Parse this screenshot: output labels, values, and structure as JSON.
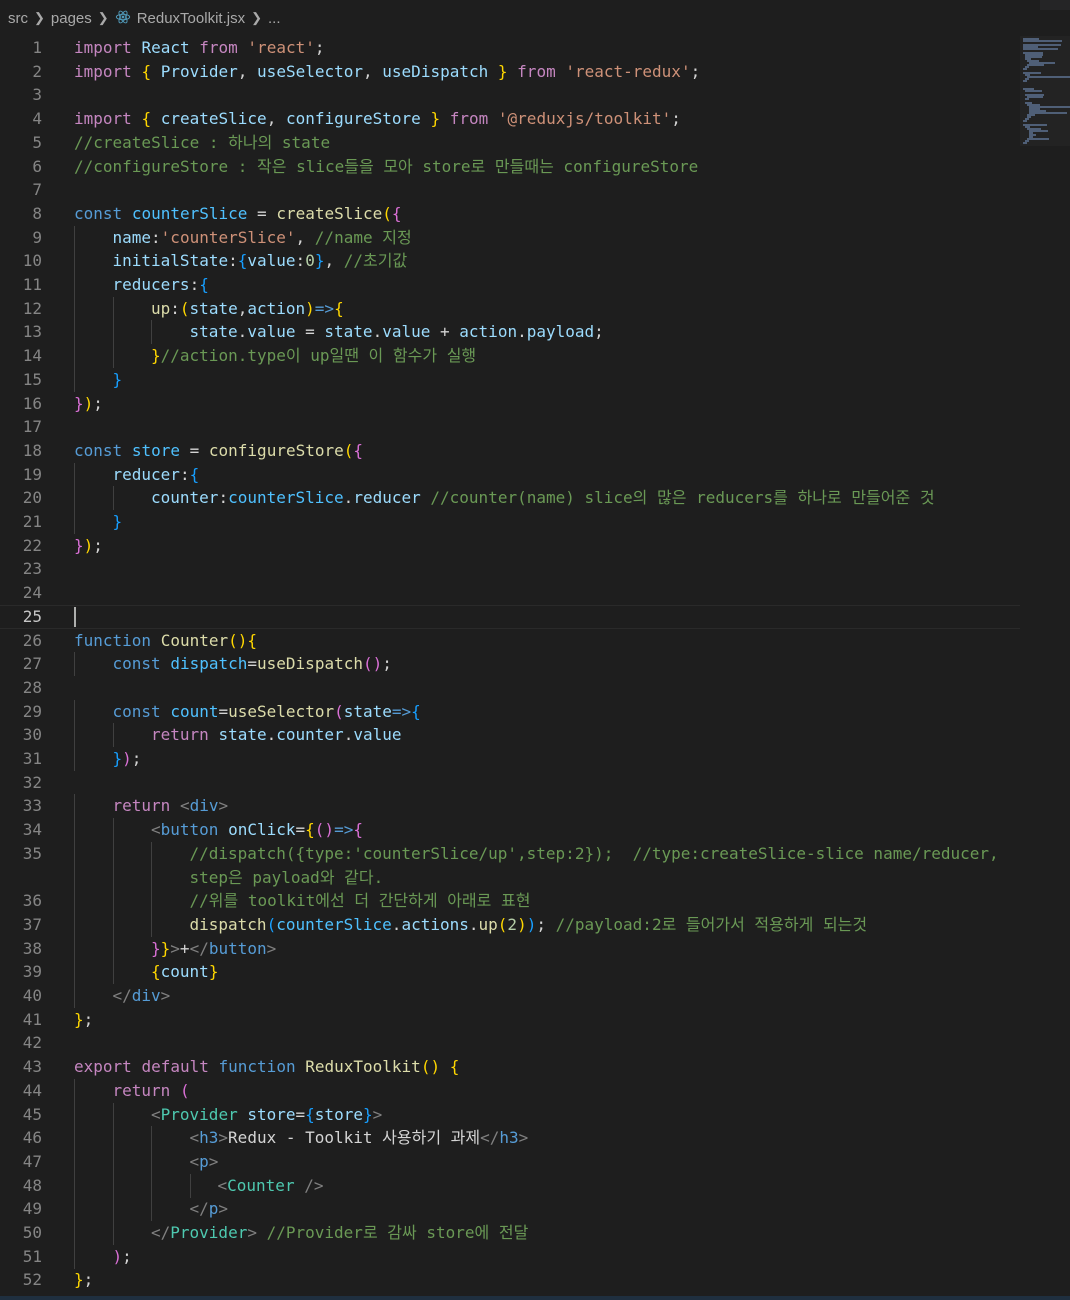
{
  "breadcrumb": {
    "items": [
      "src",
      "pages",
      "ReduxToolkit.jsx",
      "..."
    ]
  },
  "editor": {
    "current_line": 25,
    "lines": [
      {
        "n": "1",
        "indent": 0,
        "tokens": [
          [
            "c",
            "import"
          ],
          [
            "d",
            " "
          ],
          [
            "v",
            "React"
          ],
          [
            "d",
            " "
          ],
          [
            "c",
            "from"
          ],
          [
            "d",
            " "
          ],
          [
            "s",
            "'react'"
          ],
          [
            "d",
            ";"
          ]
        ]
      },
      {
        "n": "2",
        "indent": 0,
        "tokens": [
          [
            "c",
            "import"
          ],
          [
            "d",
            " "
          ],
          [
            "b1",
            "{"
          ],
          [
            "d",
            " "
          ],
          [
            "v",
            "Provider"
          ],
          [
            "d",
            ", "
          ],
          [
            "v",
            "useSelector"
          ],
          [
            "d",
            ", "
          ],
          [
            "v",
            "useDispatch"
          ],
          [
            "d",
            " "
          ],
          [
            "b1",
            "}"
          ],
          [
            "d",
            " "
          ],
          [
            "c",
            "from"
          ],
          [
            "d",
            " "
          ],
          [
            "s",
            "'react-redux'"
          ],
          [
            "d",
            ";"
          ]
        ]
      },
      {
        "n": "3",
        "indent": 0,
        "tokens": []
      },
      {
        "n": "4",
        "indent": 0,
        "tokens": [
          [
            "c",
            "import"
          ],
          [
            "d",
            " "
          ],
          [
            "b1",
            "{"
          ],
          [
            "d",
            " "
          ],
          [
            "v",
            "createSlice"
          ],
          [
            "d",
            ", "
          ],
          [
            "v",
            "configureStore"
          ],
          [
            "d",
            " "
          ],
          [
            "b1",
            "}"
          ],
          [
            "d",
            " "
          ],
          [
            "c",
            "from"
          ],
          [
            "d",
            " "
          ],
          [
            "s",
            "'@reduxjs/toolkit'"
          ],
          [
            "d",
            ";"
          ]
        ]
      },
      {
        "n": "5",
        "indent": 0,
        "tokens": [
          [
            "m",
            "//createSlice : 하나의 state"
          ]
        ]
      },
      {
        "n": "6",
        "indent": 0,
        "tokens": [
          [
            "m",
            "//configureStore : 작은 slice들을 모아 store로 만들때는 configureStore"
          ]
        ]
      },
      {
        "n": "7",
        "indent": 0,
        "tokens": []
      },
      {
        "n": "8",
        "indent": 0,
        "tokens": [
          [
            "k",
            "const"
          ],
          [
            "d",
            " "
          ],
          [
            "vc",
            "counterSlice"
          ],
          [
            "d",
            " = "
          ],
          [
            "f",
            "createSlice"
          ],
          [
            "b1",
            "("
          ],
          [
            "b2",
            "{"
          ]
        ]
      },
      {
        "n": "9",
        "indent": 1,
        "tokens": [
          [
            "v",
            "name"
          ],
          [
            "d",
            ":"
          ],
          [
            "s",
            "'counterSlice'"
          ],
          [
            "d",
            ", "
          ],
          [
            "m",
            "//name 지정"
          ]
        ]
      },
      {
        "n": "10",
        "indent": 1,
        "tokens": [
          [
            "v",
            "initialState"
          ],
          [
            "d",
            ":"
          ],
          [
            "b3",
            "{"
          ],
          [
            "v",
            "value"
          ],
          [
            "d",
            ":"
          ],
          [
            "n",
            "0"
          ],
          [
            "b3",
            "}"
          ],
          [
            "d",
            ", "
          ],
          [
            "m",
            "//초기값"
          ]
        ]
      },
      {
        "n": "11",
        "indent": 1,
        "tokens": [
          [
            "v",
            "reducers"
          ],
          [
            "d",
            ":"
          ],
          [
            "b3",
            "{"
          ]
        ]
      },
      {
        "n": "12",
        "indent": 2,
        "tokens": [
          [
            "f",
            "up"
          ],
          [
            "d",
            ":"
          ],
          [
            "b1",
            "("
          ],
          [
            "v",
            "state"
          ],
          [
            "d",
            ","
          ],
          [
            "v",
            "action"
          ],
          [
            "b1",
            ")"
          ],
          [
            "k",
            "=>"
          ],
          [
            "b1",
            "{"
          ]
        ]
      },
      {
        "n": "13",
        "indent": 3,
        "tokens": [
          [
            "v",
            "state"
          ],
          [
            "d",
            "."
          ],
          [
            "v",
            "value"
          ],
          [
            "d",
            " = "
          ],
          [
            "v",
            "state"
          ],
          [
            "d",
            "."
          ],
          [
            "v",
            "value"
          ],
          [
            "d",
            " + "
          ],
          [
            "v",
            "action"
          ],
          [
            "d",
            "."
          ],
          [
            "v",
            "payload"
          ],
          [
            "d",
            ";"
          ]
        ]
      },
      {
        "n": "14",
        "indent": 2,
        "tokens": [
          [
            "b1",
            "}"
          ],
          [
            "m",
            "//action.type이 up일땐 이 함수가 실행"
          ]
        ]
      },
      {
        "n": "15",
        "indent": 1,
        "tokens": [
          [
            "b3",
            "}"
          ]
        ]
      },
      {
        "n": "16",
        "indent": 0,
        "tokens": [
          [
            "b2",
            "}"
          ],
          [
            "b1",
            ")"
          ],
          [
            "d",
            ";"
          ]
        ]
      },
      {
        "n": "17",
        "indent": 0,
        "tokens": []
      },
      {
        "n": "18",
        "indent": 0,
        "tokens": [
          [
            "k",
            "const"
          ],
          [
            "d",
            " "
          ],
          [
            "vc",
            "store"
          ],
          [
            "d",
            " = "
          ],
          [
            "f",
            "configureStore"
          ],
          [
            "b1",
            "("
          ],
          [
            "b2",
            "{"
          ]
        ]
      },
      {
        "n": "19",
        "indent": 1,
        "tokens": [
          [
            "v",
            "reducer"
          ],
          [
            "d",
            ":"
          ],
          [
            "b3",
            "{"
          ]
        ]
      },
      {
        "n": "20",
        "indent": 2,
        "tokens": [
          [
            "v",
            "counter"
          ],
          [
            "d",
            ":"
          ],
          [
            "vc",
            "counterSlice"
          ],
          [
            "d",
            "."
          ],
          [
            "v",
            "reducer"
          ],
          [
            "d",
            " "
          ],
          [
            "m",
            "//counter(name) slice의 많은 reducers를 하나로 만들어준 것"
          ]
        ]
      },
      {
        "n": "21",
        "indent": 1,
        "tokens": [
          [
            "b3",
            "}"
          ]
        ]
      },
      {
        "n": "22",
        "indent": 0,
        "tokens": [
          [
            "b2",
            "}"
          ],
          [
            "b1",
            ")"
          ],
          [
            "d",
            ";"
          ]
        ]
      },
      {
        "n": "23",
        "indent": 0,
        "tokens": []
      },
      {
        "n": "24",
        "indent": 0,
        "tokens": []
      },
      {
        "n": "25",
        "indent": 0,
        "tokens": []
      },
      {
        "n": "26",
        "indent": 0,
        "tokens": [
          [
            "k",
            "function"
          ],
          [
            "d",
            " "
          ],
          [
            "f",
            "Counter"
          ],
          [
            "b1",
            "()"
          ],
          [
            "b1",
            "{"
          ]
        ]
      },
      {
        "n": "27",
        "indent": 1,
        "tokens": [
          [
            "k",
            "const"
          ],
          [
            "d",
            " "
          ],
          [
            "vc",
            "dispatch"
          ],
          [
            "d",
            "="
          ],
          [
            "f",
            "useDispatch"
          ],
          [
            "b2",
            "()"
          ],
          [
            "d",
            ";"
          ]
        ]
      },
      {
        "n": "28",
        "indent": 0,
        "tokens": []
      },
      {
        "n": "29",
        "indent": 1,
        "tokens": [
          [
            "k",
            "const"
          ],
          [
            "d",
            " "
          ],
          [
            "vc",
            "count"
          ],
          [
            "d",
            "="
          ],
          [
            "f",
            "useSelector"
          ],
          [
            "b2",
            "("
          ],
          [
            "v",
            "state"
          ],
          [
            "k",
            "=>"
          ],
          [
            "b3",
            "{"
          ]
        ]
      },
      {
        "n": "30",
        "indent": 2,
        "tokens": [
          [
            "c",
            "return"
          ],
          [
            "d",
            " "
          ],
          [
            "v",
            "state"
          ],
          [
            "d",
            "."
          ],
          [
            "v",
            "counter"
          ],
          [
            "d",
            "."
          ],
          [
            "v",
            "value"
          ]
        ]
      },
      {
        "n": "31",
        "indent": 1,
        "tokens": [
          [
            "b3",
            "}"
          ],
          [
            "b2",
            ")"
          ],
          [
            "d",
            ";"
          ]
        ]
      },
      {
        "n": "32",
        "indent": 0,
        "tokens": []
      },
      {
        "n": "33",
        "indent": 1,
        "tokens": [
          [
            "c",
            "return"
          ],
          [
            "d",
            " "
          ],
          [
            "p",
            "<"
          ],
          [
            "tg",
            "div"
          ],
          [
            "p",
            ">"
          ]
        ]
      },
      {
        "n": "34",
        "indent": 2,
        "tokens": [
          [
            "p",
            "<"
          ],
          [
            "tg",
            "button"
          ],
          [
            "d",
            " "
          ],
          [
            "v",
            "onClick"
          ],
          [
            "d",
            "="
          ],
          [
            "b1",
            "{"
          ],
          [
            "b2",
            "()"
          ],
          [
            "k",
            "=>"
          ],
          [
            "b2",
            "{"
          ]
        ]
      },
      {
        "n": "35",
        "indent": 3,
        "tokens": [
          [
            "m",
            "//dispatch({type:'counterSlice/up',step:2});  //type:createSlice-slice name/reducer,"
          ]
        ]
      },
      {
        "n": "",
        "indent": 3,
        "tokens": [
          [
            "m",
            "step은 payload와 같다."
          ]
        ]
      },
      {
        "n": "36",
        "indent": 3,
        "tokens": [
          [
            "m",
            "//위를 toolkit에선 더 간단하게 아래로 표현"
          ]
        ]
      },
      {
        "n": "37",
        "indent": 3,
        "tokens": [
          [
            "f",
            "dispatch"
          ],
          [
            "b3",
            "("
          ],
          [
            "vc",
            "counterSlice"
          ],
          [
            "d",
            "."
          ],
          [
            "v",
            "actions"
          ],
          [
            "d",
            "."
          ],
          [
            "f",
            "up"
          ],
          [
            "b1",
            "("
          ],
          [
            "n",
            "2"
          ],
          [
            "b1",
            ")"
          ],
          [
            "b3",
            ")"
          ],
          [
            "d",
            "; "
          ],
          [
            "m",
            "//payload:2로 들어가서 적용하게 되는것"
          ]
        ]
      },
      {
        "n": "38",
        "indent": 2,
        "tokens": [
          [
            "b2",
            "}"
          ],
          [
            "b1",
            "}"
          ],
          [
            "p",
            ">"
          ],
          [
            "d",
            "+"
          ],
          [
            "p",
            "</"
          ],
          [
            "tg",
            "button"
          ],
          [
            "p",
            ">"
          ]
        ]
      },
      {
        "n": "39",
        "indent": 2,
        "tokens": [
          [
            "b1",
            "{"
          ],
          [
            "v",
            "count"
          ],
          [
            "b1",
            "}"
          ]
        ]
      },
      {
        "n": "40",
        "indent": 1,
        "tokens": [
          [
            "p",
            "</"
          ],
          [
            "tg",
            "div"
          ],
          [
            "p",
            ">"
          ]
        ]
      },
      {
        "n": "41",
        "indent": 0,
        "tokens": [
          [
            "b1",
            "}"
          ],
          [
            "d",
            ";"
          ]
        ]
      },
      {
        "n": "42",
        "indent": 0,
        "tokens": []
      },
      {
        "n": "43",
        "indent": 0,
        "tokens": [
          [
            "c",
            "export"
          ],
          [
            "d",
            " "
          ],
          [
            "c",
            "default"
          ],
          [
            "d",
            " "
          ],
          [
            "k",
            "function"
          ],
          [
            "d",
            " "
          ],
          [
            "f",
            "ReduxToolkit"
          ],
          [
            "b1",
            "()"
          ],
          [
            "d",
            " "
          ],
          [
            "b1",
            "{"
          ]
        ]
      },
      {
        "n": "44",
        "indent": 1,
        "tokens": [
          [
            "c",
            "return"
          ],
          [
            "d",
            " "
          ],
          [
            "b2",
            "("
          ]
        ]
      },
      {
        "n": "45",
        "indent": 2,
        "tokens": [
          [
            "p",
            "<"
          ],
          [
            "t",
            "Provider"
          ],
          [
            "d",
            " "
          ],
          [
            "v",
            "store"
          ],
          [
            "d",
            "="
          ],
          [
            "b3",
            "{"
          ],
          [
            "v",
            "store"
          ],
          [
            "b3",
            "}"
          ],
          [
            "p",
            ">"
          ]
        ]
      },
      {
        "n": "46",
        "indent": 3,
        "tokens": [
          [
            "p",
            "<"
          ],
          [
            "tg",
            "h3"
          ],
          [
            "p",
            ">"
          ],
          [
            "d",
            "Redux - Toolkit 사용하기 과제"
          ],
          [
            "p",
            "</"
          ],
          [
            "tg",
            "h3"
          ],
          [
            "p",
            ">"
          ]
        ]
      },
      {
        "n": "47",
        "indent": 3,
        "tokens": [
          [
            "p",
            "<"
          ],
          [
            "tg",
            "p"
          ],
          [
            "p",
            ">"
          ]
        ]
      },
      {
        "n": "48",
        "indent": 3,
        "extra": "    ",
        "tokens": [
          [
            "p",
            "<"
          ],
          [
            "t",
            "Counter"
          ],
          [
            "d",
            " "
          ],
          [
            "p",
            "/>"
          ]
        ]
      },
      {
        "n": "49",
        "indent": 3,
        "tokens": [
          [
            "p",
            "</"
          ],
          [
            "tg",
            "p"
          ],
          [
            "p",
            ">"
          ]
        ]
      },
      {
        "n": "50",
        "indent": 2,
        "tokens": [
          [
            "p",
            "</"
          ],
          [
            "t",
            "Provider"
          ],
          [
            "p",
            ">"
          ],
          [
            "d",
            " "
          ],
          [
            "m",
            "//Provider로 감싸 store에 전달"
          ]
        ]
      },
      {
        "n": "51",
        "indent": 1,
        "tokens": [
          [
            "b2",
            ")"
          ],
          [
            "d",
            ";"
          ]
        ]
      },
      {
        "n": "52",
        "indent": 0,
        "tokens": [
          [
            "b1",
            "}"
          ],
          [
            "d",
            ";"
          ]
        ]
      }
    ]
  },
  "colors": {
    "background": "#1e1e1e",
    "comment": "#6a9955",
    "keyword": "#569cd6",
    "control": "#c586c0",
    "string": "#ce9178",
    "function": "#dcdcaa",
    "variable": "#9cdcfe",
    "constant": "#4fc1ff",
    "type": "#4ec9b0"
  }
}
